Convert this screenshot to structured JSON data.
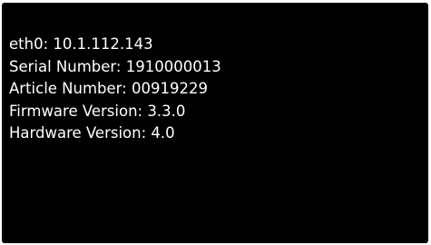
{
  "device_info": {
    "lines": [
      "eth0: 10.1.112.143",
      "Serial Number: 1910000013",
      "Article Number: 00919229",
      "Firmware Version: 3.3.0",
      "Hardware Version: 4.0"
    ]
  },
  "colors": {
    "screen_background": "#000000",
    "text": "#ffffff",
    "border": "#ffffff"
  }
}
